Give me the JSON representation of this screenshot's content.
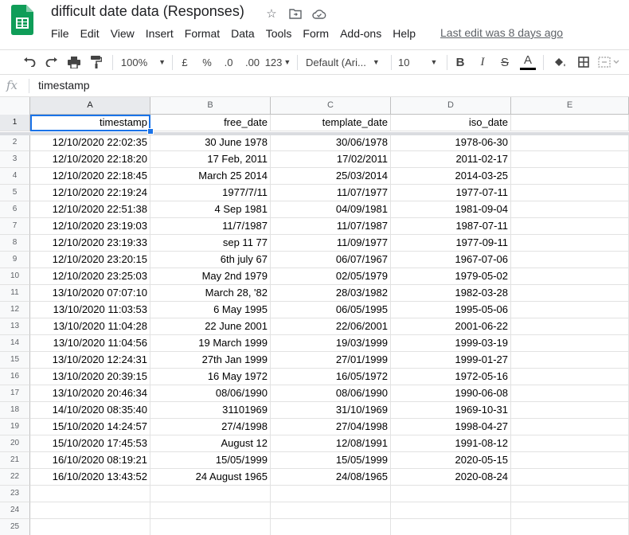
{
  "title": "difficult date data (Responses)",
  "menu": [
    "File",
    "Edit",
    "View",
    "Insert",
    "Format",
    "Data",
    "Tools",
    "Form",
    "Add-ons",
    "Help"
  ],
  "last_edit": "Last edit was 8 days ago",
  "toolbar": {
    "zoom": "100%",
    "currency": "£",
    "percent": "%",
    "decimal_decrease": ".0",
    "decimal_increase": ".00",
    "more_formats": "123",
    "font": "Default (Ari...",
    "font_size": "10",
    "bold": "B",
    "italic": "I",
    "strikethrough": "S",
    "text_color": "A"
  },
  "formula_bar": {
    "fx": "fx",
    "content": "timestamp"
  },
  "columns": [
    "A",
    "B",
    "C",
    "D",
    "E"
  ],
  "rows": [
    [
      "timestamp",
      "free_date",
      "template_date",
      "iso_date",
      ""
    ],
    [
      "12/10/2020 22:02:35",
      "30 June 1978",
      "30/06/1978",
      "1978-06-30",
      ""
    ],
    [
      "12/10/2020 22:18:20",
      "17 Feb, 2011",
      "17/02/2011",
      "2011-02-17",
      ""
    ],
    [
      "12/10/2020 22:18:45",
      "March 25 2014",
      "25/03/2014",
      "2014-03-25",
      ""
    ],
    [
      "12/10/2020 22:19:24",
      "1977/7/11",
      "11/07/1977",
      "1977-07-11",
      ""
    ],
    [
      "12/10/2020 22:51:38",
      "4 Sep 1981",
      "04/09/1981",
      "1981-09-04",
      ""
    ],
    [
      "12/10/2020 23:19:03",
      "11/7/1987",
      "11/07/1987",
      "1987-07-11",
      ""
    ],
    [
      "12/10/2020 23:19:33",
      "sep 11 77",
      "11/09/1977",
      "1977-09-11",
      ""
    ],
    [
      "12/10/2020 23:20:15",
      "6th july 67",
      "06/07/1967",
      "1967-07-06",
      ""
    ],
    [
      "12/10/2020 23:25:03",
      "May 2nd 1979",
      "02/05/1979",
      "1979-05-02",
      ""
    ],
    [
      "13/10/2020 07:07:10",
      "March 28, '82",
      "28/03/1982",
      "1982-03-28",
      ""
    ],
    [
      "13/10/2020 11:03:53",
      "6 May 1995",
      "06/05/1995",
      "1995-05-06",
      ""
    ],
    [
      "13/10/2020 11:04:28",
      "22 June 2001",
      "22/06/2001",
      "2001-06-22",
      ""
    ],
    [
      "13/10/2020 11:04:56",
      "19 March 1999",
      "19/03/1999",
      "1999-03-19",
      ""
    ],
    [
      "13/10/2020 12:24:31",
      "27th Jan 1999",
      "27/01/1999",
      "1999-01-27",
      ""
    ],
    [
      "13/10/2020 20:39:15",
      "16 May 1972",
      "16/05/1972",
      "1972-05-16",
      ""
    ],
    [
      "13/10/2020 20:46:34",
      "08/06/1990",
      "08/06/1990",
      "1990-06-08",
      ""
    ],
    [
      "14/10/2020 08:35:40",
      "31101969",
      "31/10/1969",
      "1969-10-31",
      ""
    ],
    [
      "15/10/2020 14:24:57",
      "27/4/1998",
      "27/04/1998",
      "1998-04-27",
      ""
    ],
    [
      "15/10/2020 17:45:53",
      "August 12",
      "12/08/1991",
      "1991-08-12",
      ""
    ],
    [
      "16/10/2020 08:19:21",
      "15/05/1999",
      "15/05/1999",
      "2020-05-15",
      ""
    ],
    [
      "16/10/2020 13:43:52",
      "24 August 1965",
      "24/08/1965",
      "2020-08-24",
      ""
    ],
    [
      "",
      "",
      "",
      "",
      ""
    ],
    [
      "",
      "",
      "",
      "",
      ""
    ],
    [
      "",
      "",
      "",
      "",
      ""
    ]
  ]
}
